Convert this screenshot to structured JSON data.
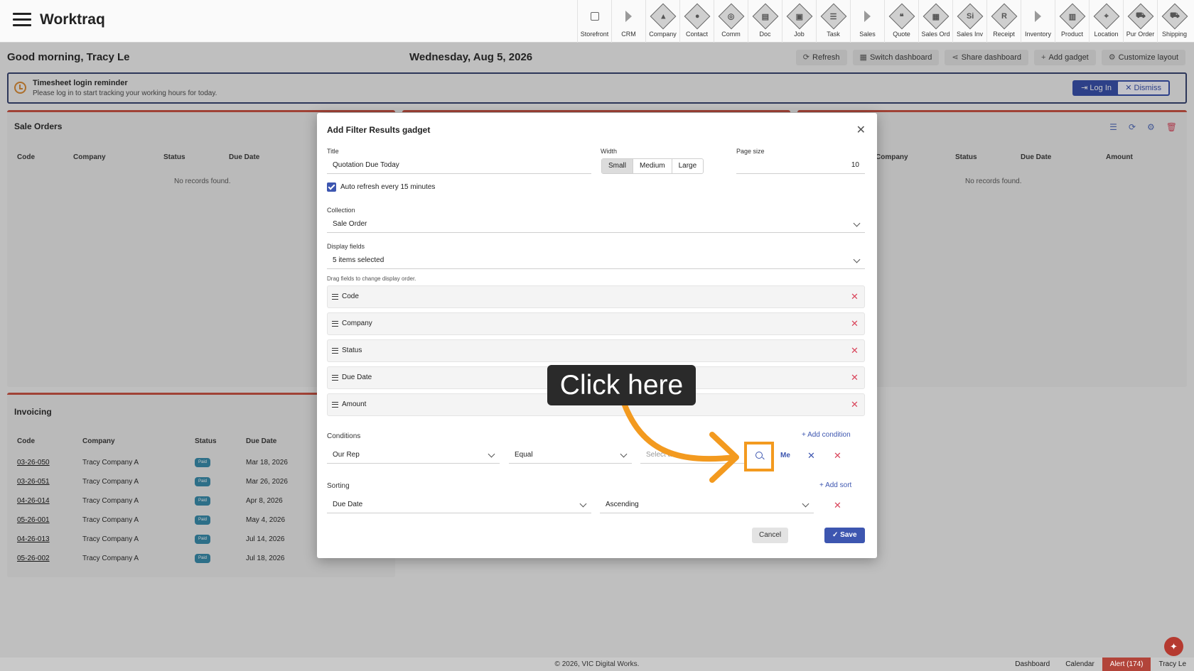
{
  "app": {
    "title": "Worktraq"
  },
  "modules": [
    {
      "label": "Storefront",
      "icon": "external-link-icon",
      "kind": "ext"
    },
    {
      "label": "CRM",
      "icon": "section-arrow-icon",
      "kind": "tri"
    },
    {
      "label": "Company",
      "icon": "company-icon",
      "kind": "diam",
      "glyph": "▲"
    },
    {
      "label": "Contact",
      "icon": "contact-icon",
      "kind": "diam",
      "glyph": "●"
    },
    {
      "label": "Comm",
      "icon": "comm-icon",
      "kind": "diam",
      "glyph": "◎"
    },
    {
      "label": "Doc",
      "icon": "doc-icon",
      "kind": "diam",
      "glyph": "▤"
    },
    {
      "label": "Job",
      "icon": "job-icon",
      "kind": "diam",
      "glyph": "▣"
    },
    {
      "label": "Task",
      "icon": "task-icon",
      "kind": "diam",
      "glyph": "☰"
    },
    {
      "label": "Sales",
      "icon": "section-arrow-icon",
      "kind": "tri"
    },
    {
      "label": "Quote",
      "icon": "quote-icon",
      "kind": "diam",
      "glyph": "❝"
    },
    {
      "label": "Sales Ord",
      "icon": "sales-order-icon",
      "kind": "diam",
      "glyph": "▦"
    },
    {
      "label": "Sales Inv",
      "icon": "sales-invoice-icon",
      "kind": "diam",
      "glyph": "Si"
    },
    {
      "label": "Receipt",
      "icon": "receipt-icon",
      "kind": "diam",
      "glyph": "R"
    },
    {
      "label": "Inventory",
      "icon": "section-arrow-icon",
      "kind": "tri"
    },
    {
      "label": "Product",
      "icon": "product-icon",
      "kind": "diam",
      "glyph": "▥"
    },
    {
      "label": "Location",
      "icon": "location-icon",
      "kind": "diam",
      "glyph": "⌖"
    },
    {
      "label": "Pur Order",
      "icon": "purchase-order-icon",
      "kind": "diam",
      "glyph": "⛟"
    },
    {
      "label": "Shipping",
      "icon": "shipping-icon",
      "kind": "diam",
      "glyph": "⛟"
    }
  ],
  "header": {
    "greeting": "Good morning, Tracy Le",
    "date": "Wednesday, Aug 5, 2026"
  },
  "toolbar": {
    "refresh": "Refresh",
    "switch": "Switch dashboard",
    "share": "Share dashboard",
    "add": "Add gadget",
    "customize": "Customize layout"
  },
  "reminder": {
    "title": "Timesheet login reminder",
    "text": "Please log in to start tracking your working hours for today.",
    "login": "Log In",
    "dismiss": "Dismiss"
  },
  "sale_orders": {
    "title": "Sale Orders",
    "headers": [
      "Code",
      "Company",
      "Status",
      "Due Date"
    ],
    "empty": "No records found."
  },
  "right_panel": {
    "headers": [
      "Company",
      "Status",
      "Due Date",
      "Amount"
    ],
    "empty": "No records found."
  },
  "invoicing": {
    "title": "Invoicing",
    "headers": [
      "Code",
      "Company",
      "Status",
      "Due Date"
    ],
    "rows": [
      {
        "code": "03-26-050",
        "company": "Tracy Company A",
        "status": "Paid",
        "due": "Mar 18, 2026"
      },
      {
        "code": "03-26-051",
        "company": "Tracy Company A",
        "status": "Paid",
        "due": "Mar 26, 2026"
      },
      {
        "code": "04-26-014",
        "company": "Tracy Company A",
        "status": "Paid",
        "due": "Apr 8, 2026"
      },
      {
        "code": "05-26-001",
        "company": "Tracy Company A",
        "status": "Paid",
        "due": "May 4, 2026"
      },
      {
        "code": "04-26-013",
        "company": "Tracy Company A",
        "status": "Paid",
        "due": "Jul 14, 2026"
      },
      {
        "code": "05-26-002",
        "company": "Tracy Company A",
        "status": "Paid",
        "due": "Jul 18, 2026"
      }
    ]
  },
  "modal": {
    "title": "Add Filter Results gadget",
    "title_label": "Title",
    "title_value": "Quotation Due Today",
    "width_label": "Width",
    "widths": [
      "Small",
      "Medium",
      "Large"
    ],
    "width_selected": "Small",
    "page_size_label": "Page size",
    "page_size": "10",
    "auto_refresh": "Auto refresh every 15 minutes",
    "collection_label": "Collection",
    "collection": "Sale Order",
    "display_label": "Display fields",
    "display_value": "5 items selected",
    "drag_hint": "Drag fields to change display order.",
    "fields": [
      "Code",
      "Company",
      "Status",
      "Due Date",
      "Amount"
    ],
    "conditions_label": "Conditions",
    "add_condition": "Add condition",
    "cond_field": "Our Rep",
    "cond_op": "Equal",
    "cond_value_placeholder": "Select a",
    "me": "Me",
    "sorting_label": "Sorting",
    "add_sort": "Add sort",
    "sort_field": "Due Date",
    "sort_dir": "Ascending",
    "cancel": "Cancel",
    "save": "Save"
  },
  "tooltip": {
    "text": "Click here"
  },
  "footer": {
    "copyright": "© 2026, VIC Digital Works.",
    "dashboard": "Dashboard",
    "calendar": "Calendar",
    "alert": "Alert (174)",
    "user": "Tracy Le"
  },
  "colors": {
    "accent": "#3d56b0",
    "highlight": "#f39a1f",
    "danger": "#d9455b",
    "panel_border": "#c84b3b"
  }
}
